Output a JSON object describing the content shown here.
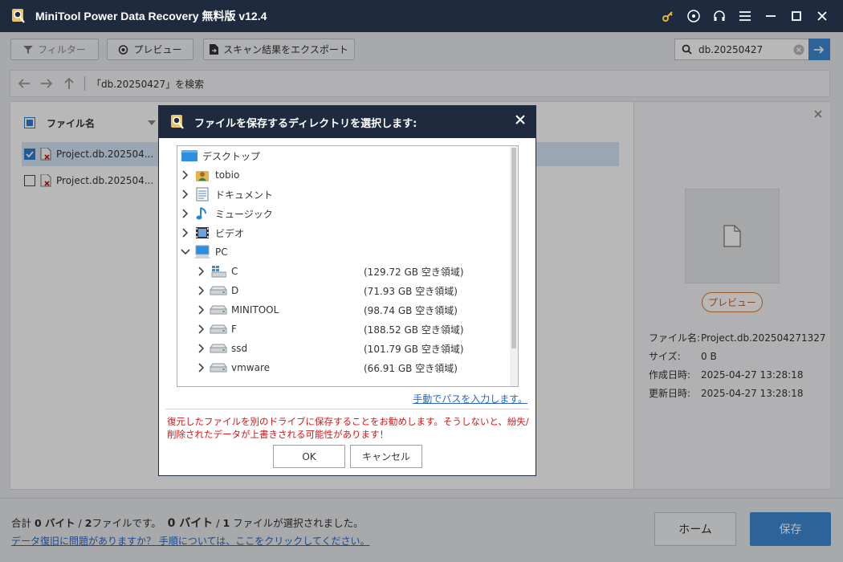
{
  "titlebar": {
    "title": "MiniTool Power Data Recovery 無料版 v12.4"
  },
  "toolbar": {
    "filter_label": "フィルター",
    "preview_label": "プレビュー",
    "export_label": "スキャン結果をエクスポート"
  },
  "search": {
    "value": "db.20250427"
  },
  "navbar": {
    "path": "「db.20250427」を検索"
  },
  "list": {
    "column_name": "ファイル名",
    "rows": [
      {
        "name": "Project.db.202504...",
        "checked": true
      },
      {
        "name": "Project.db.202504...",
        "checked": false
      }
    ]
  },
  "preview": {
    "button_label": "プレビュー",
    "props": [
      {
        "key": "ファイル名:",
        "value": "Project.db.202504271327"
      },
      {
        "key": "サイズ:",
        "value": "0 B"
      },
      {
        "key": "作成日時:",
        "value": "2025-04-27 13:28:18"
      },
      {
        "key": "更新日時:",
        "value": "2025-04-27 13:28:18"
      }
    ]
  },
  "footer": {
    "sum_pre": "合計",
    "sum_bytes": "0 バイト",
    "sum_mid": "/",
    "sum_files": "2",
    "sum_post": "ファイルです。",
    "sel_bytes": "0 バイト",
    "sel_mid": "/",
    "sel_files": "1",
    "sel_post": "ファイルが選択されました。",
    "help_link": "データ復旧に問題がありますか？ 手順については、ここをクリックしてください。",
    "home_label": "ホーム",
    "save_label": "保存"
  },
  "dialog": {
    "title": "ファイルを保存するディレクトリを選択します:",
    "tree": [
      {
        "label": "デスクトップ",
        "icon": "desktop-icon",
        "level": 0,
        "arrow": "none",
        "space": ""
      },
      {
        "label": "tobio",
        "icon": "user-folder-icon",
        "level": 1,
        "arrow": "right",
        "space": ""
      },
      {
        "label": "ドキュメント",
        "icon": "documents-icon",
        "level": 1,
        "arrow": "right",
        "space": ""
      },
      {
        "label": "ミュージック",
        "icon": "music-icon",
        "level": 1,
        "arrow": "right",
        "space": ""
      },
      {
        "label": "ビデオ",
        "icon": "video-icon",
        "level": 1,
        "arrow": "right",
        "space": ""
      },
      {
        "label": "PC",
        "icon": "pc-icon",
        "level": 1,
        "arrow": "down",
        "space": ""
      },
      {
        "label": "C",
        "icon": "windows-drive-icon",
        "level": 2,
        "arrow": "right",
        "space": "(129.72 GB 空き領域)"
      },
      {
        "label": "D",
        "icon": "drive-icon",
        "level": 2,
        "arrow": "right",
        "space": "(71.93 GB 空き領域)"
      },
      {
        "label": "MINITOOL",
        "icon": "drive-icon",
        "level": 2,
        "arrow": "right",
        "space": "(98.74 GB 空き領域)"
      },
      {
        "label": "F",
        "icon": "drive-icon",
        "level": 2,
        "arrow": "right",
        "space": "(188.52 GB 空き領域)"
      },
      {
        "label": "ssd",
        "icon": "drive-icon",
        "level": 2,
        "arrow": "right",
        "space": "(101.79 GB 空き領域)"
      },
      {
        "label": "vmware",
        "icon": "drive-icon",
        "level": 2,
        "arrow": "right",
        "space": "(66.91 GB 空き領域)"
      }
    ],
    "manual_link": "手動でパスを入力します。",
    "warning": "復元したファイルを別のドライブに保存することをお勧めします。そうしないと、紛失/削除されたデータが上書きされる可能性があります！",
    "ok_label": "OK",
    "cancel_label": "キャンセル"
  },
  "colors": {
    "titlebar": "#1e2a3e",
    "accent": "#3e8bd6",
    "warning": "#d41616",
    "link": "#2b66c4"
  }
}
